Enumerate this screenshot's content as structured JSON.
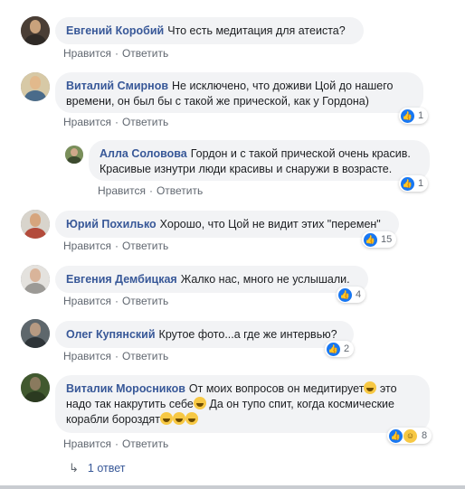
{
  "actions": {
    "like": "Нравится",
    "reply": "Ответить",
    "separator": "·"
  },
  "comments": [
    {
      "author": "Евгений Коробий",
      "text": "Что есть медитация для атеиста?",
      "reactions": null,
      "avatar_color": "#6b5b4b"
    },
    {
      "author": "Виталий Смирнов",
      "text": "Не исключено, что доживи Цой до нашего времени, он был бы с такой же прической, как у Гордона)",
      "reactions": {
        "count": "1",
        "types": [
          "like"
        ]
      },
      "avatar_color": "#c9a56f"
    },
    {
      "author": "Алла Соловова",
      "text": "Гордон и с такой прической очень красив. Красивые изнутри люди красивы и снаружи в возрасте.",
      "reactions": {
        "count": "1",
        "types": [
          "like"
        ]
      },
      "avatar_color": "#7a8f5a"
    },
    {
      "author": "Юрий Похилько",
      "text": "Хорошо, что Цой не видит этих \"перемен\"",
      "reactions": {
        "count": "15",
        "types": [
          "like"
        ]
      },
      "avatar_color": "#b34b3b"
    },
    {
      "author": "Евгения Дембицкая",
      "text": "Жалко нас, много не услышали.",
      "reactions": {
        "count": "4",
        "types": [
          "like"
        ]
      },
      "avatar_color": "#c3c0bb"
    },
    {
      "author": "Олег Купянский",
      "text": "Крутое фото...а где же интервью?",
      "reactions": {
        "count": "2",
        "types": [
          "like"
        ]
      },
      "avatar_color": "#707a80"
    },
    {
      "author": "Виталик Моросников",
      "text_parts": [
        "От моих вопросов он медитирует",
        "это надо так накрутить себе",
        "Да он тупо спит, когда космические корабли бороздят"
      ],
      "reactions": {
        "count": "8",
        "types": [
          "like",
          "haha"
        ]
      },
      "avatar_color": "#4f6a3f"
    }
  ],
  "replies_link": "1 ответ"
}
